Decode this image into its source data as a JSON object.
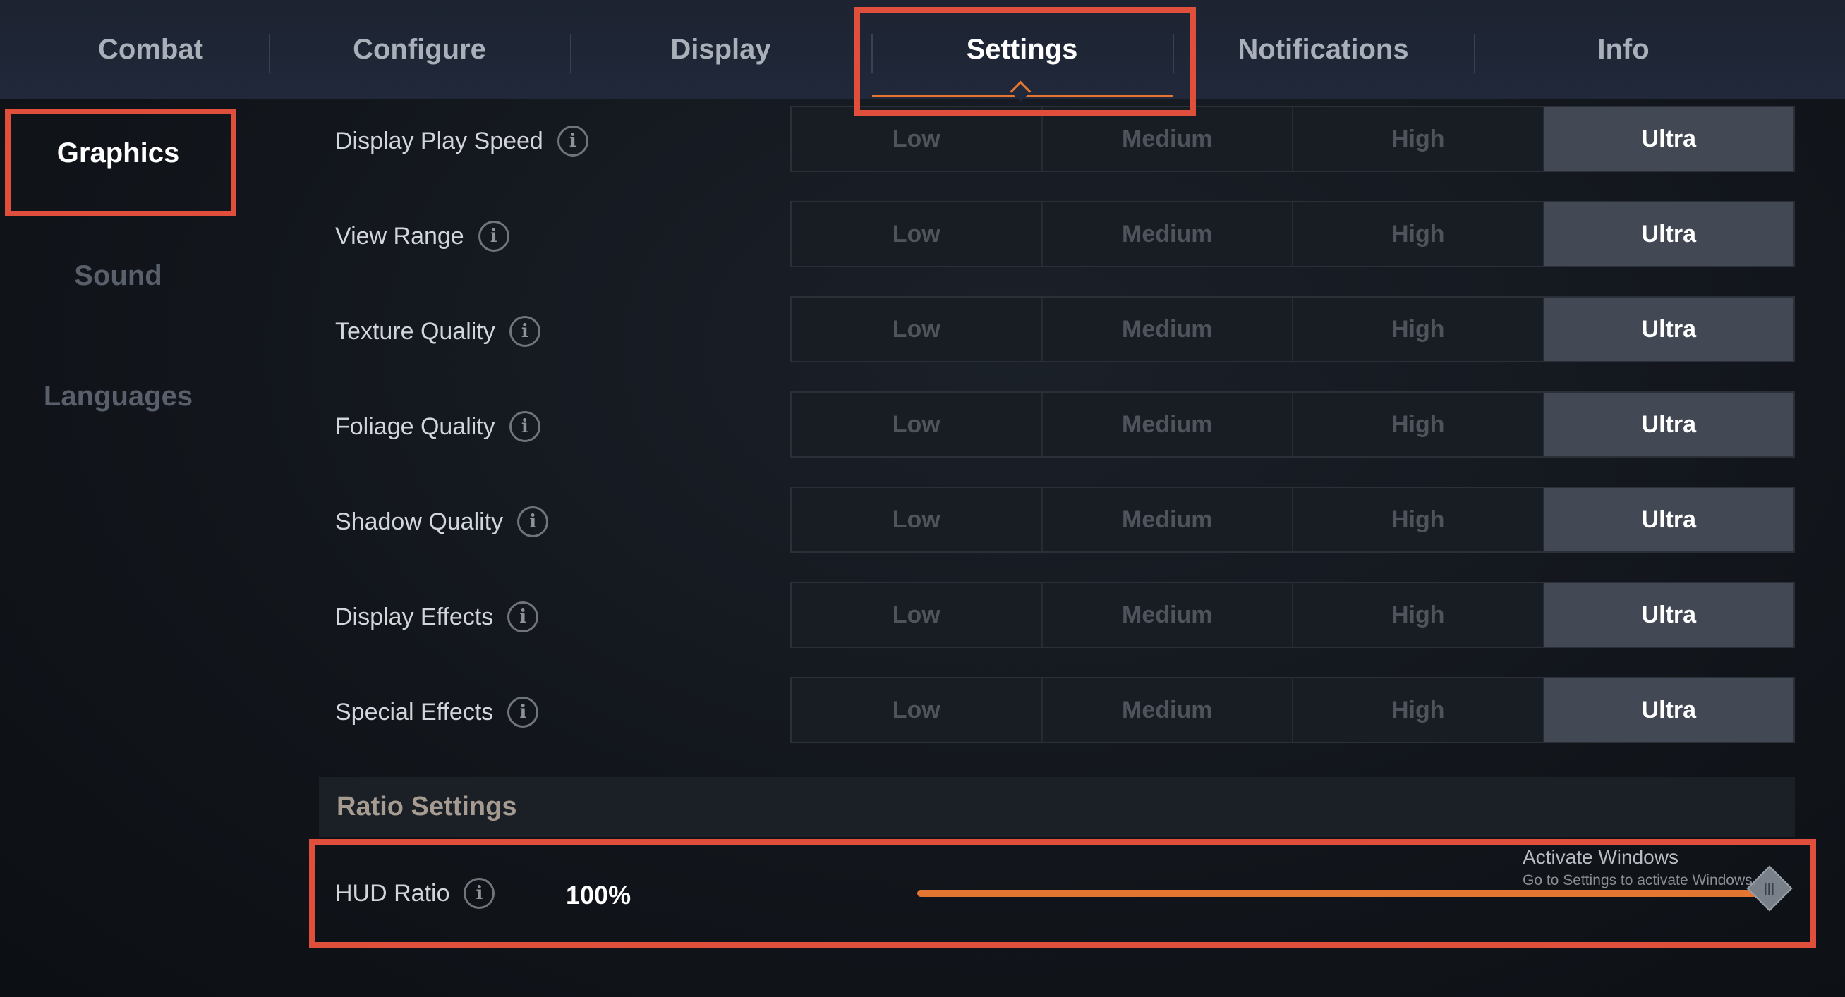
{
  "tabs": [
    {
      "label": "Combat"
    },
    {
      "label": "Configure"
    },
    {
      "label": "Display"
    },
    {
      "label": "Settings"
    },
    {
      "label": "Notifications"
    },
    {
      "label": "Info"
    }
  ],
  "active_tab": "Settings",
  "sidebar": {
    "items": [
      {
        "label": "Graphics"
      },
      {
        "label": "Sound"
      },
      {
        "label": "Languages"
      }
    ],
    "active": "Graphics"
  },
  "graphics": {
    "options": [
      "Low",
      "Medium",
      "High",
      "Ultra"
    ],
    "rows": [
      {
        "label": "Display Play Speed",
        "selected": "Ultra"
      },
      {
        "label": "View Range",
        "selected": "Ultra"
      },
      {
        "label": "Texture Quality",
        "selected": "Ultra"
      },
      {
        "label": "Foliage Quality",
        "selected": "Ultra"
      },
      {
        "label": "Shadow Quality",
        "selected": "Ultra"
      },
      {
        "label": "Display Effects",
        "selected": "Ultra"
      },
      {
        "label": "Special Effects",
        "selected": "Ultra"
      }
    ]
  },
  "ratio_settings": {
    "header": "Ratio Settings",
    "hud_label": "HUD Ratio",
    "hud_value": "100%",
    "hud_fraction": 1.0
  },
  "info_icon": "info-icon",
  "watermark": {
    "title": "Activate Windows",
    "subtitle": "Go to Settings to activate Windows."
  },
  "colors": {
    "accent": "#e57631",
    "highlight_box": "#e04e3c",
    "selected_option_bg": "#434954"
  }
}
